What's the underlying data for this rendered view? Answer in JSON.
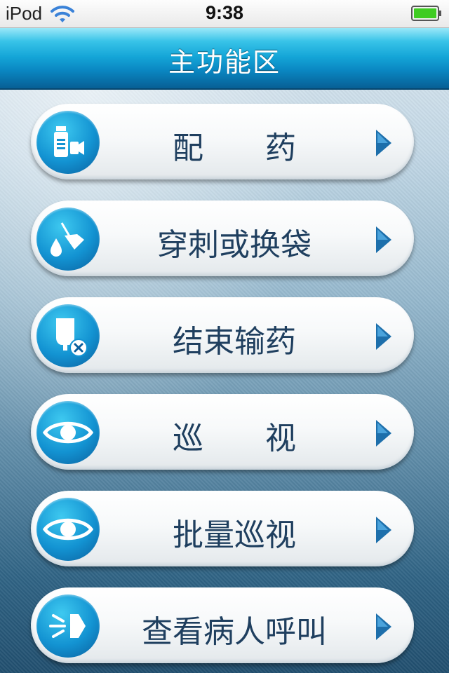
{
  "status_bar": {
    "carrier": "iPod",
    "time": "9:38",
    "wifi_icon": "wifi-icon",
    "battery_icon": "battery-full-icon",
    "battery_color": "#3fcc22"
  },
  "nav": {
    "title": "主功能区"
  },
  "colors": {
    "nav_blue": "#14a5d7",
    "icon_blue": "#1393d2",
    "label_text": "#1f3f5f",
    "arrow_blue": "#1d6fab"
  },
  "menu": [
    {
      "label": "配　　药",
      "icon": "medicine-bottle-icon"
    },
    {
      "label": "穿刺或换袋",
      "icon": "needle-drop-icon"
    },
    {
      "label": "结束输药",
      "icon": "iv-bag-stop-icon"
    },
    {
      "label": "巡　　视",
      "icon": "eye-icon"
    },
    {
      "label": "批量巡视",
      "icon": "eye-icon"
    },
    {
      "label": "查看病人呼叫",
      "icon": "call-signal-icon"
    }
  ]
}
